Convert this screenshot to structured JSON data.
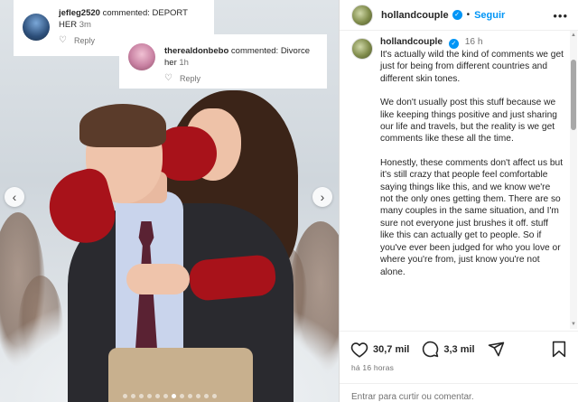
{
  "comments": [
    {
      "username": "jefleg2520",
      "text": "commented: DEPORT HER",
      "time": "3m",
      "reply_label": "Reply"
    },
    {
      "username": "therealdonbebo",
      "text": "commented: Divorce her",
      "time": "1h",
      "reply_label": "Reply"
    }
  ],
  "post": {
    "username": "hollandcouple",
    "separator": "•",
    "follow_label": "Seguir",
    "more_label": "•••",
    "caption_time": "16 h",
    "caption_paragraphs": [
      "It's actually wild the kind of comments we get just for being from different countries and different skin tones.",
      "We don't usually post this stuff because we like keeping things positive and just sharing our life and travels, but the reality is we get comments like these all the time.",
      "Honestly, these comments don't affect us but it's still crazy that people feel comfortable saying things like this, and we know we're not the only ones getting them. There are so many couples in the same situation, and I'm sure not everyone just brushes it off. stuff like this can actually get to people. So if you've ever been judged for who you love or where you're from, just know you're not alone."
    ],
    "likes": "30,7 mil",
    "comments_count": "3,3 mil",
    "posted_ago": "há 16 horas",
    "login_link": "Entrar",
    "login_text": " para curtir ou comentar."
  },
  "carousel": {
    "slide_count": 12,
    "active_index": 6
  },
  "colors": {
    "accent": "#0095f6",
    "muted": "#737373",
    "text": "#262626"
  }
}
